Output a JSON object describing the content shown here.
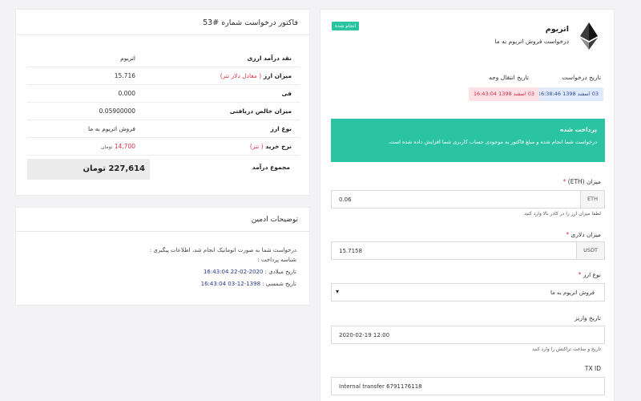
{
  "invoice": {
    "title": "فاکتور درخواست شماره #53",
    "rows": [
      {
        "label": "نقد درآمد ارزی",
        "value": "اتریوم"
      },
      {
        "label": "میزان ارز",
        "note": "( معادل دلار تتر)",
        "value": "15.716"
      },
      {
        "label": "فی",
        "value": "0.000"
      },
      {
        "label": "میزان خالص دریافتی",
        "value": "0.05900000"
      },
      {
        "label": "نوع ارز",
        "value": "فروش اتریوم به ما"
      },
      {
        "label": "نرخ خرید",
        "note": "( تتر)",
        "value": "14,700",
        "unit": "تومان"
      }
    ],
    "total_label": "مجموع درآمد",
    "total_value": "227,614 تومان"
  },
  "admin": {
    "title": "توضیحات ادمین",
    "line1": "درخواست شما به صورت اتوماتیک انجام شد، اطلاعات پیگیری :",
    "line2": "شناسه پرداخت :",
    "line3_label": "تاریخ میلادی :",
    "line3_value": "2020-02-22 16:43:04",
    "line4_label": "تاریخ شمسی :",
    "line4_value": "1398-12-03 16:43:04"
  },
  "request": {
    "coin_name": "اتریوم",
    "coin_desc": "درخواست فروش اتریوم به ما",
    "status_tag": "انجام شده",
    "req_date_label": "تاریخ درخواست",
    "trans_date_label": "تاریخ انتقال وجه",
    "req_date": "03 اسفند 1398 16:38:46",
    "trans_date": "03 اسفند 1398 16:43:04",
    "paid_title": "پرداخت شده",
    "paid_text": "درخواست شما انجام شده و مبلغ فاکتور به موجودی حساب کاربری شما افزایش داده شده است.",
    "amount_label": "میزان (ETH)",
    "amount_value": "0.06",
    "amount_unit": "ETH",
    "amount_help": "لطفا میزان ارز را در کادر بالا وارد کنید",
    "usd_label": "میزان دلاری",
    "usd_value": "15.7158",
    "usd_unit": "USDT",
    "type_label": "نوع ارز",
    "type_value": "فروش اتریوم به ما",
    "deposit_label": "تاریخ واریز",
    "deposit_value": "2020-02-19 12:00",
    "deposit_help": "تاریخ و ساعت تراکنش را وارد کنید",
    "txid_label": "TX ID",
    "txid_value": "Internal transfer 6791176118",
    "required_mark": "*"
  },
  "colors": {
    "accent_green": "#2bc4a3",
    "red": "#e2334b",
    "blue_pill": "#e0eaff",
    "red_pill": "#fde1e5"
  }
}
